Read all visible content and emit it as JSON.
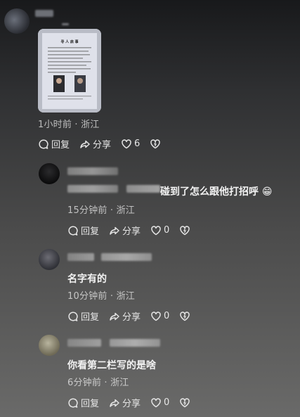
{
  "main_comment": {
    "time": "1小时前",
    "location": "浙江",
    "reply_label": "回复",
    "share_label": "分享",
    "likes": "6",
    "poster_title": "寻 人 启 事"
  },
  "replies": [
    {
      "text": "碰到了怎么跟他打招呼 😁",
      "time": "15分钟前",
      "location": "浙江",
      "reply_label": "回复",
      "share_label": "分享",
      "likes": "0"
    },
    {
      "text": "名字有的",
      "time": "10分钟前",
      "location": "浙江",
      "reply_label": "回复",
      "share_label": "分享",
      "likes": "0"
    },
    {
      "text": "你看第二栏写的是啥",
      "time": "6分钟前",
      "location": "浙江",
      "reply_label": "回复",
      "share_label": "分享",
      "likes": "0"
    }
  ],
  "separator": "·",
  "colors": {
    "accent_like": "#e6e6e6"
  },
  "icons": [
    "comment-icon",
    "share-icon",
    "heart-icon",
    "dislike-heart-icon"
  ]
}
